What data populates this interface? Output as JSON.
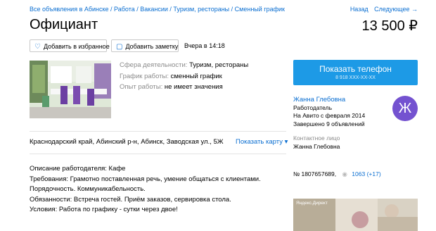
{
  "breadcrumbs": "Все объявления в Абинске / Работа / Вакансии / Туризм, рестораны / Сменный график",
  "nav": {
    "back": "Назад",
    "next": "Следующее →"
  },
  "title": "Официант",
  "price": "13 500 ₽",
  "actions": {
    "favorite": "Добавить в избранное",
    "note": "Добавить заметку",
    "posted": "Вчера в 14:18"
  },
  "params": [
    {
      "key": "Сфера деятельности:",
      "value": "Туризм, рестораны"
    },
    {
      "key": "График работы:",
      "value": "сменный график"
    },
    {
      "key": "Опыт работы:",
      "value": "не имеет значения"
    }
  ],
  "phone": {
    "label": "Показать телефон",
    "number": "8 918 XXX-XX-XX"
  },
  "seller": {
    "name": "Жанна Глебовна",
    "role": "Работодатель",
    "since": "На Авито с февраля 2014",
    "completed": "Завершено 9 объявлений",
    "avatar_letter": "Ж"
  },
  "contact": {
    "label": "Контактное лицо",
    "name": "Жанна Глебовна"
  },
  "address": "Краснодарский край, Абинский р-н, Абинск, Заводская ул., 5Ж",
  "show_map": "Показать карту ▾",
  "description": [
    "Описание работодателя: Кафе",
    "Требования: Грамотно поставленная речь, умение общаться с клиентами.",
    "Порядочность. Коммуникабельность.",
    "Обязанности: Встреча гостей. Приём заказов, сервировка стола.",
    "Условия: Работа по графику - сутки через двое!"
  ],
  "ad_number": "№ 1807657689,",
  "views": "1063 (+17)",
  "ad_label": "Яндекс.Директ",
  "colors": {
    "accent": "#1d9ae6",
    "link": "#0a6ed1",
    "avatar": "#7452d0"
  }
}
